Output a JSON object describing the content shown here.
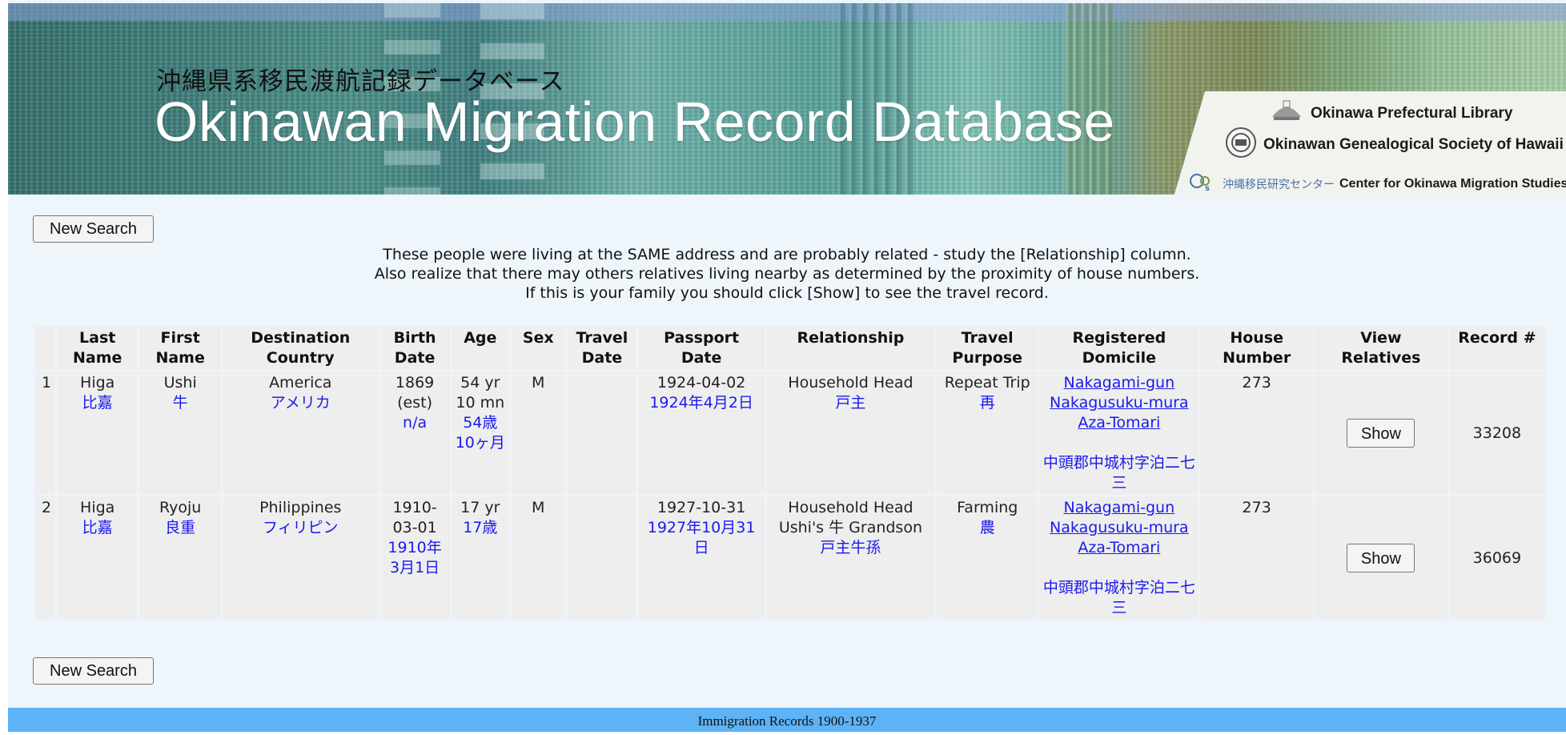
{
  "banner": {
    "title_jp": "沖縄県系移民渡航記録データベース",
    "title_en": "Okinawan Migration Record Database",
    "orgs": [
      {
        "name": "Okinawa Prefectural Library"
      },
      {
        "name": "Okinawan Genealogical Society of Hawaii"
      },
      {
        "name_jp": "沖縄移民研究センター",
        "name": "Center for Okinawa Migration Studies"
      }
    ]
  },
  "buttons": {
    "new_search": "New Search",
    "show": "Show"
  },
  "notice": [
    "These people were living at the SAME address and are probably related - study the [Relationship] column.",
    "Also realize that there may others relatives living nearby as determined by the proximity of house numbers.",
    "If this is your family you should click [Show] to see the travel record."
  ],
  "table": {
    "headers": [
      "",
      "Last Name",
      "First Name",
      "Destination Country",
      "Birth Date",
      "Age",
      "Sex",
      "Travel Date",
      "Passport Date",
      "Relationship",
      "Travel Purpose",
      "Registered Domicile",
      "House Number",
      "View Relatives",
      "Record #"
    ],
    "rows": [
      {
        "num": "1",
        "last_en": "Higa",
        "last_jp": "比嘉",
        "first_en": "Ushi",
        "first_jp": "牛",
        "dest_en": "America",
        "dest_jp": "アメリカ",
        "birth_en": "1869 (est)",
        "birth_jp": "n/a",
        "age_en": "54 yr 10 mn",
        "age_jp": "54歳10ヶ月",
        "sex": "M",
        "travel_date": "",
        "passport_en": "1924-04-02",
        "passport_jp": "1924年4月2日",
        "rel_en": "Household Head",
        "rel_jp": "戸主",
        "purpose_en": "Repeat Trip",
        "purpose_jp": "再",
        "domicile_en": "Nakagami-gun Nakagusuku-mura Aza-Tomari",
        "domicile_jp": "中頭郡中城村字泊二七三",
        "house": "273",
        "record": "33208"
      },
      {
        "num": "2",
        "last_en": "Higa",
        "last_jp": "比嘉",
        "first_en": "Ryoju",
        "first_jp": "良重",
        "dest_en": "Philippines",
        "dest_jp": "フィリピン",
        "birth_en": "1910-03-01",
        "birth_jp": "1910年3月1日",
        "age_en": "17 yr",
        "age_jp": "17歳",
        "sex": "M",
        "travel_date": "",
        "passport_en": "1927-10-31",
        "passport_jp": "1927年10月31日",
        "rel_en": "Household Head",
        "rel_en2": "Ushi's 牛 Grandson",
        "rel_jp": "戸主牛孫",
        "purpose_en": "Farming",
        "purpose_jp": "農",
        "domicile_en": "Nakagami-gun Nakagusuku-mura Aza-Tomari",
        "domicile_jp": "中頭郡中城村字泊二七三",
        "house": "273",
        "record": "36069"
      }
    ]
  },
  "footer": "Immigration Records 1900-1937"
}
